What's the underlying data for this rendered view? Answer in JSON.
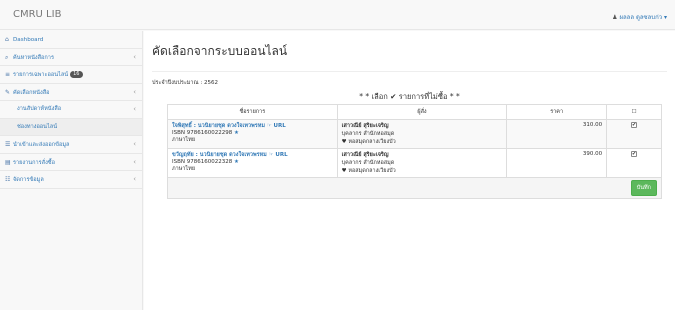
{
  "header": {
    "brand": "CMRU LIB",
    "user_label": "ผลลล ดูลซลบก่ว ▾"
  },
  "sidebar": {
    "items": [
      {
        "icon": "⌂",
        "label": "Dashboard"
      },
      {
        "icon": "⌕",
        "label": "ค้นหาหนังสือการ",
        "chev": "‹"
      },
      {
        "icon": "≡",
        "label": "รายการเฉพาะออนไลน์",
        "badge": "16"
      },
      {
        "icon": "✎",
        "label": "คัดเลือกหนังสือ",
        "chev": "‹"
      },
      {
        "label": "งานสัปดาห์หนังสือ",
        "chev": "‹"
      },
      {
        "label": "ช่องทางออนไลน์"
      },
      {
        "icon": "☰",
        "label": "นำเข้าและส่งออกข้อมูล",
        "chev": "‹"
      },
      {
        "icon": "▤",
        "label": "รายงานการสั่งซื้อ",
        "chev": "‹"
      },
      {
        "icon": "☷",
        "label": "จัดการข้อมูล",
        "chev": "‹"
      }
    ]
  },
  "main": {
    "title": "คัดเลือกจากระบบออนไลน์",
    "year_label": "ประจำปีงบประมาณ : 2562",
    "hint": "* * เลือก ✔ รายการที่ไม่ซื้อ * *",
    "columns": [
      "ชื่อรายการ",
      "ผู้สั่ง",
      "ราคา",
      "☐"
    ],
    "rows": [
      {
        "title": "ใจพิสุทธิ์ : นวนิยายชุด ดวงใจเทวพรหม",
        "url": "☞ URL",
        "isbn": "ISBN 9786160022298",
        "lang": "ภาษาไทย",
        "orderer": "เสาวณีย์ สุริยะเจริญ",
        "orderer_role": "บุคลากร สำนักหอสมุด",
        "orderer_loc": "♥ หอสมุดกลางเวียงบัว",
        "price": "310.00",
        "checked": "✔"
      },
      {
        "title": "ขวัญฤทัย : นวนิยายชุด ดวงใจเทวพรหม",
        "url": "☞ URL",
        "isbn": "ISBN 9786160022328",
        "lang": "ภาษาไทย",
        "orderer": "เสาวณีย์ สุริยะเจริญ",
        "orderer_role": "บุคลากร สำนักหอสมุด",
        "orderer_loc": "♥ หอสมุดกลางเวียงบัว",
        "price": "390.00",
        "checked": "✔"
      }
    ],
    "save_label": "บันทึก"
  }
}
